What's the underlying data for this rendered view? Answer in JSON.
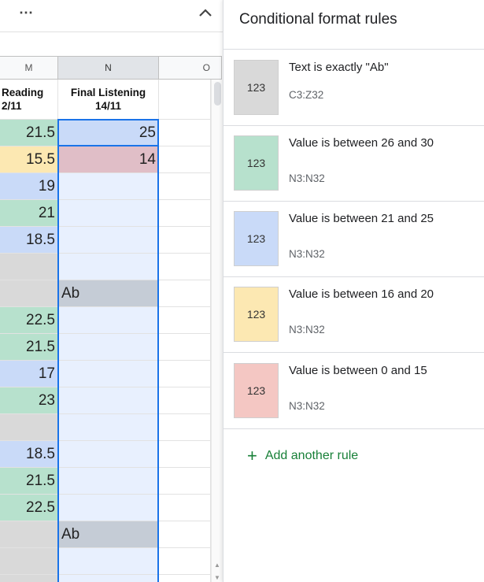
{
  "sheet": {
    "columns": [
      "M",
      "N",
      "O"
    ],
    "header_m": {
      "line1": "Reading",
      "line2": "2/11"
    },
    "header_n": {
      "line1": "Final Listening",
      "line2": "14/11"
    },
    "col_m": [
      "21.5",
      "15.5",
      "19",
      "21",
      "18.5",
      "",
      "",
      "22.5",
      "21.5",
      "17",
      "23",
      "",
      "18.5",
      "21.5",
      "22.5",
      "",
      "",
      ""
    ],
    "col_n": [
      "25",
      "14",
      "",
      "",
      "",
      "",
      "Ab",
      "",
      "",
      "",
      "",
      "",
      "",
      "",
      "",
      "Ab",
      "",
      ""
    ],
    "colors": {
      "green": "#b7e1cd",
      "blue": "#c9daf8",
      "yellow": "#fce8b2",
      "pink": "#e0bec7",
      "gray": "#d9d9d9",
      "ab_gray": "#c5ccd6",
      "selection_bg": "#e8f0fe",
      "selection_border": "#1a73e8"
    }
  },
  "panel": {
    "title": "Conditional format rules",
    "rules": [
      {
        "swatch_label": "123",
        "condition": "Text is exactly \"Ab\"",
        "range": "C3:Z32",
        "color": "#d9d9d9"
      },
      {
        "swatch_label": "123",
        "condition": "Value is between 26 and 30",
        "range": "N3:N32",
        "color": "#b7e1cd"
      },
      {
        "swatch_label": "123",
        "condition": "Value is between 21 and 25",
        "range": "N3:N32",
        "color": "#c9daf8"
      },
      {
        "swatch_label": "123",
        "condition": "Value is between 16 and 20",
        "range": "N3:N32",
        "color": "#fce8b2"
      },
      {
        "swatch_label": "123",
        "condition": "Value is between 0 and 15",
        "range": "N3:N32",
        "color": "#f4c7c3"
      }
    ],
    "add_rule_label": "Add another rule"
  }
}
